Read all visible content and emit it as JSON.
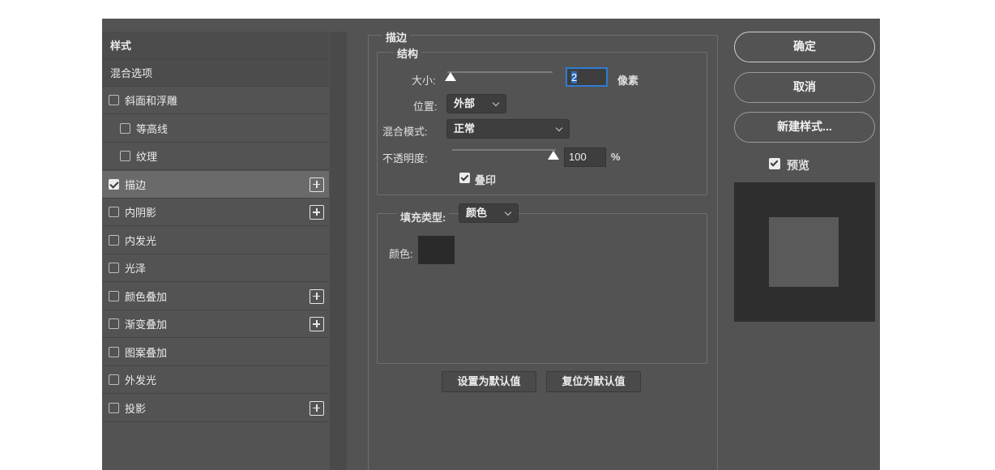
{
  "style_list": {
    "header": "样式",
    "blend_options": "混合选项",
    "items": [
      {
        "label": "斜面和浮雕",
        "checked": false,
        "indent": false,
        "plus": false
      },
      {
        "label": "等高线",
        "checked": false,
        "indent": true,
        "plus": false
      },
      {
        "label": "纹理",
        "checked": false,
        "indent": true,
        "plus": false
      },
      {
        "label": "描边",
        "checked": true,
        "indent": false,
        "plus": true,
        "selected": true
      },
      {
        "label": "内阴影",
        "checked": false,
        "indent": false,
        "plus": true
      },
      {
        "label": "内发光",
        "checked": false,
        "indent": false,
        "plus": false
      },
      {
        "label": "光泽",
        "checked": false,
        "indent": false,
        "plus": false
      },
      {
        "label": "颜色叠加",
        "checked": false,
        "indent": false,
        "plus": true
      },
      {
        "label": "渐变叠加",
        "checked": false,
        "indent": false,
        "plus": true
      },
      {
        "label": "图案叠加",
        "checked": false,
        "indent": false,
        "plus": false
      },
      {
        "label": "外发光",
        "checked": false,
        "indent": false,
        "plus": false
      },
      {
        "label": "投影",
        "checked": false,
        "indent": false,
        "plus": true
      }
    ]
  },
  "stroke": {
    "title": "描边",
    "structure": {
      "title": "结构",
      "size_label": "大小:",
      "size_value": "2",
      "size_unit": "像素",
      "size_fraction": 0.01,
      "position_label": "位置:",
      "position_value": "外部",
      "blend_mode_label": "混合模式:",
      "blend_mode_value": "正常",
      "opacity_label": "不透明度:",
      "opacity_value": "100",
      "opacity_unit": "%",
      "overprint_label": "叠印",
      "overprint_checked": true
    },
    "fill": {
      "type_label": "填充类型:",
      "type_value": "颜色",
      "color_label": "颜色:",
      "color": "#2a2a2a"
    },
    "make_default": "设置为默认值",
    "reset_default": "复位为默认值"
  },
  "actions": {
    "ok": "确定",
    "cancel": "取消",
    "new_style": "新建样式...",
    "preview_label": "预览",
    "preview_checked": true
  },
  "colors": {
    "dialog_bg": "#535353",
    "selected_row": "#6a6a6a",
    "focus": "#2f7dd3"
  }
}
